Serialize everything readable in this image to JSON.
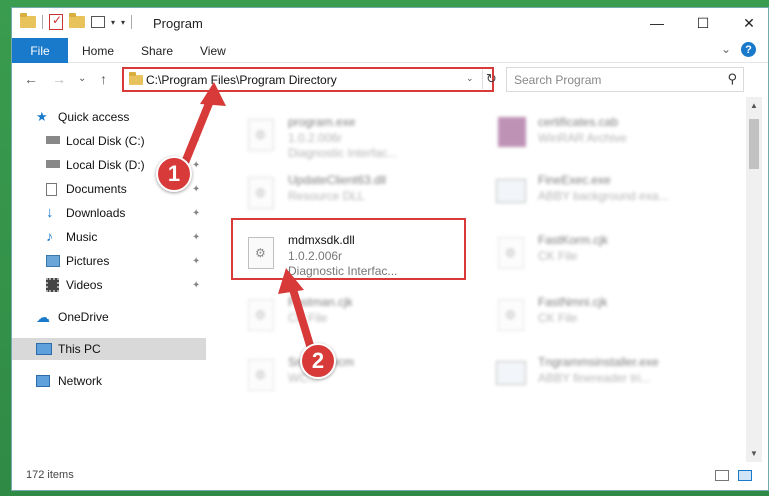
{
  "window": {
    "title": "Program",
    "minimize": "—",
    "maximize": "☐",
    "close": "✕"
  },
  "ribbon": {
    "file": "File",
    "tabs": [
      "Home",
      "Share",
      "View"
    ],
    "expand": "⌄",
    "help": "?"
  },
  "nav": {
    "back": "←",
    "forward": "→",
    "recent": "⌄",
    "up": "↑",
    "address": "C:\\Program Files\\Program Directory",
    "address_dropdown": "⌄",
    "refresh": "↻",
    "search_placeholder": "Search Program",
    "search_icon": "search-icon"
  },
  "sidebar": {
    "items": [
      {
        "label": "Quick access",
        "icon": "star-icon"
      },
      {
        "label": "Local Disk (C:)",
        "icon": "drive-icon"
      },
      {
        "label": "Local Disk (D:)",
        "icon": "drive-icon"
      },
      {
        "label": "Documents",
        "icon": "documents-icon"
      },
      {
        "label": "Downloads",
        "icon": "download-icon"
      },
      {
        "label": "Music",
        "icon": "music-icon"
      },
      {
        "label": "Pictures",
        "icon": "pictures-icon"
      },
      {
        "label": "Videos",
        "icon": "videos-icon"
      },
      {
        "label": "OneDrive",
        "icon": "cloud-icon"
      },
      {
        "label": "This PC",
        "icon": "pc-icon"
      },
      {
        "label": "Network",
        "icon": "network-icon"
      }
    ],
    "pin": "📌"
  },
  "files": [
    {
      "name": "program.exe",
      "sub1": "1.0.2.006r",
      "sub2": "Diagnostic Interfac..."
    },
    {
      "name": "certificates.cab",
      "sub1": "WinRAR Archive",
      "sub2": ""
    },
    {
      "name": "UpdateClient63.dll",
      "sub1": "Resource DLL",
      "sub2": ""
    },
    {
      "name": "FineExec.exe",
      "sub1": "ABBY background exa...",
      "sub2": ""
    },
    {
      "name": "mdmxsdk.dll",
      "sub1": "1.0.2.006r",
      "sub2": "Diagnostic Interfac..."
    },
    {
      "name": "FastKorm.cjk",
      "sub1": "CK File",
      "sub2": ""
    },
    {
      "name": "Fastman.cjk",
      "sub1": "CK File",
      "sub2": ""
    },
    {
      "name": "FastNmni.cjk",
      "sub1": "CK File",
      "sub2": ""
    },
    {
      "name": "Sn...15.wcm",
      "sub1": "WC...",
      "sub2": ""
    },
    {
      "name": "Tngrammsinstaller.exe",
      "sub1": "ABBY finereader tri...",
      "sub2": ""
    }
  ],
  "annotations": {
    "badge1": "1",
    "badge2": "2"
  },
  "status": {
    "count": "172 items"
  },
  "scroll": {
    "up": "▲",
    "down": "▼"
  },
  "colors": {
    "accent": "#1979ca",
    "highlight": "#d83a3a"
  }
}
